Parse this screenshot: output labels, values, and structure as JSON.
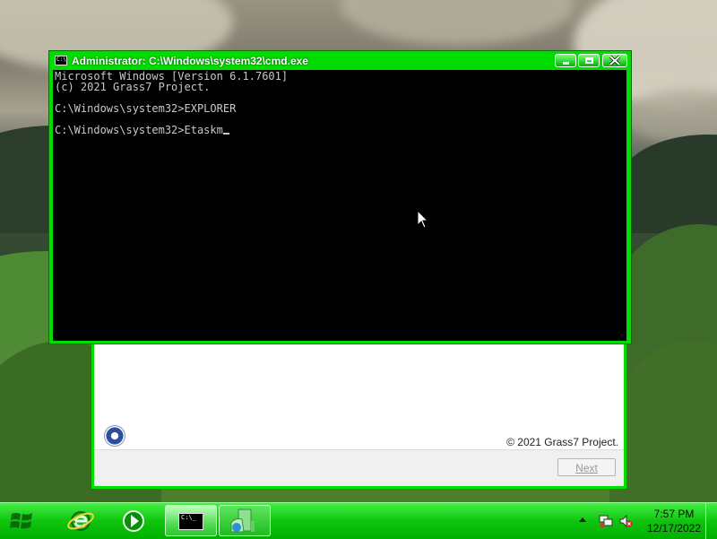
{
  "cmd_window": {
    "title": "Administrator: C:\\Windows\\system32\\cmd.exe",
    "icon": "cmd-icon",
    "icon_text": "C:\\",
    "lines": [
      "Microsoft Windows [Version 6.1.7601]",
      "(c) 2021 Grass7 Project.",
      "",
      "C:\\Windows\\system32>EXPLORER",
      "",
      "C:\\Windows\\system32>Etaskm"
    ],
    "buttons": {
      "minimize": "minimize-icon",
      "maximize": "maximize-icon",
      "close": "close-icon"
    }
  },
  "setup_window": {
    "copyright": "© 2021 Grass7 Project.",
    "next_label": "Next"
  },
  "taskbar": {
    "start": "start-windows-icon",
    "pinned": [
      "internet-explorer-icon",
      "media-player-icon"
    ],
    "task_icon_text": "C:\\_",
    "clock_time": "7:57 PM",
    "clock_date": "12/17/2022"
  },
  "colors": {
    "accent": "#00dc00",
    "console_bg": "#000000",
    "console_text": "#c8c8c8"
  }
}
